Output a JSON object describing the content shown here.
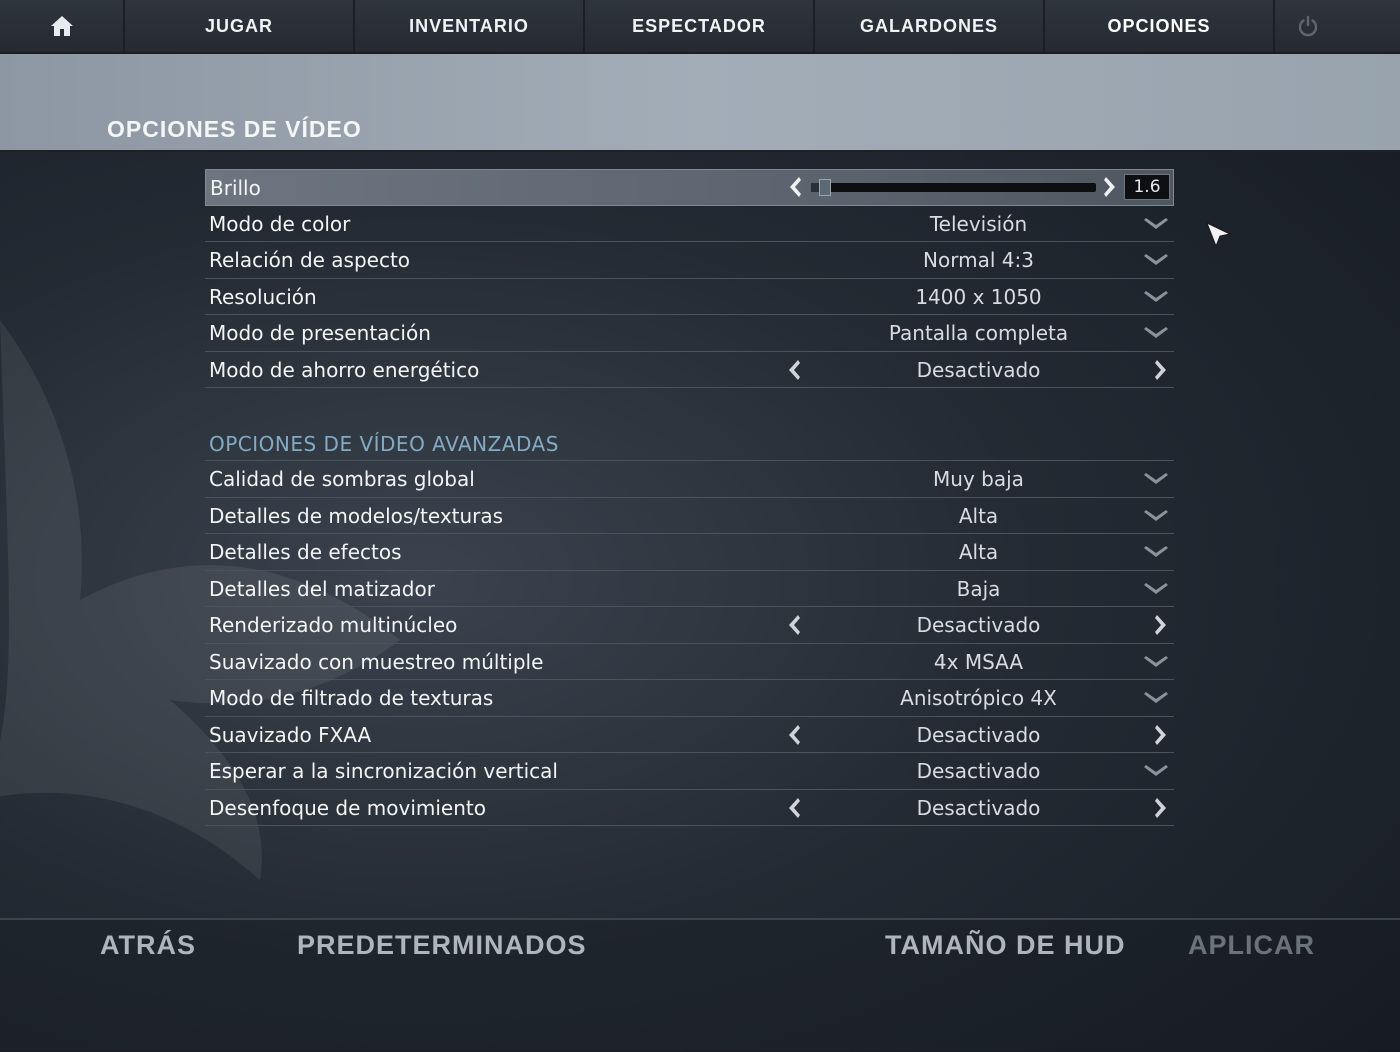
{
  "nav": {
    "home_icon": "home-icon",
    "tabs": [
      {
        "label": "JUGAR"
      },
      {
        "label": "INVENTARIO"
      },
      {
        "label": "ESPECTADOR"
      },
      {
        "label": "GALARDONES"
      },
      {
        "label": "OPCIONES"
      }
    ],
    "power_icon": "power-icon"
  },
  "header": {
    "title": "OPCIONES DE VÍDEO"
  },
  "basic": {
    "brightness": {
      "label": "Brillo",
      "value": "1.6",
      "level": 0.03
    },
    "rows": [
      {
        "label": "Modo de color",
        "value": "Televisión",
        "control": "dropdown"
      },
      {
        "label": "Relación de aspecto",
        "value": "Normal 4:3",
        "control": "dropdown"
      },
      {
        "label": "Resolución",
        "value": "1400 x 1050",
        "control": "dropdown"
      },
      {
        "label": "Modo de presentación",
        "value": "Pantalla completa",
        "control": "dropdown"
      },
      {
        "label": "Modo de ahorro energético",
        "value": "Desactivado",
        "control": "toggle"
      }
    ]
  },
  "advanced": {
    "title": "OPCIONES DE VÍDEO AVANZADAS",
    "rows": [
      {
        "label": "Calidad de sombras global",
        "value": "Muy baja",
        "control": "dropdown"
      },
      {
        "label": "Detalles de modelos/texturas",
        "value": "Alta",
        "control": "dropdown"
      },
      {
        "label": "Detalles de efectos",
        "value": "Alta",
        "control": "dropdown"
      },
      {
        "label": "Detalles del matizador",
        "value": "Baja",
        "control": "dropdown"
      },
      {
        "label": "Renderizado multinúcleo",
        "value": "Desactivado",
        "control": "toggle"
      },
      {
        "label": "Suavizado con muestreo múltiple",
        "value": "4x MSAA",
        "control": "dropdown"
      },
      {
        "label": "Modo de filtrado de texturas",
        "value": "Anisotrópico 4X",
        "control": "dropdown"
      },
      {
        "label": "Suavizado FXAA",
        "value": "Desactivado",
        "control": "toggle"
      },
      {
        "label": "Esperar a la sincronización vertical",
        "value": "Desactivado",
        "control": "dropdown"
      },
      {
        "label": "Desenfoque de movimiento",
        "value": "Desactivado",
        "control": "toggle"
      }
    ]
  },
  "footer": {
    "back": "ATRÁS",
    "defaults": "PREDETERMINADOS",
    "hud_size": "TAMAÑO DE HUD",
    "apply": "APLICAR"
  },
  "colors": {
    "accent_section": "#86aac2",
    "header_band": "#a3adb8"
  }
}
